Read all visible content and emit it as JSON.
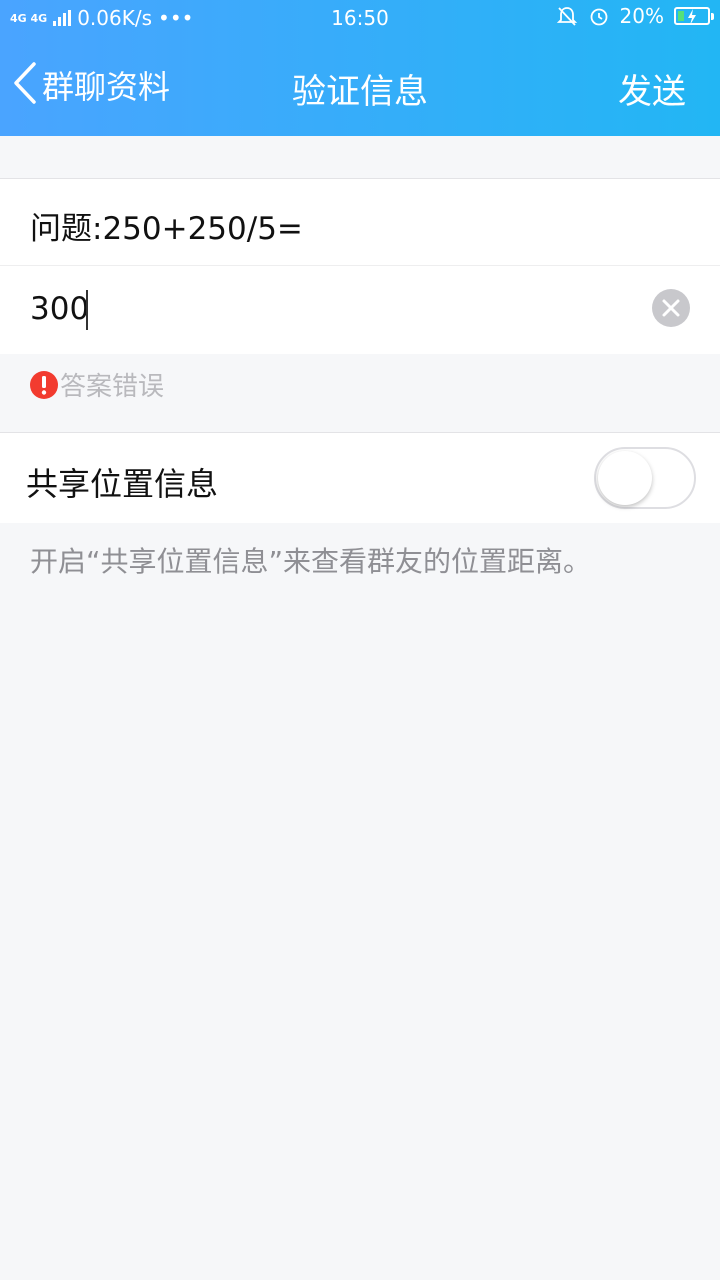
{
  "status_bar": {
    "network": "4G 4G",
    "speed": "0.06K/s",
    "more": "•••",
    "time": "16:50",
    "battery": "20%",
    "battery_level": 0.2
  },
  "nav": {
    "back_label": "群聊资料",
    "title": "验证信息",
    "send_label": "发送"
  },
  "question": {
    "text": "问题:250+250/5="
  },
  "answer": {
    "value": "300"
  },
  "error": {
    "text": "答案错误"
  },
  "share_location": {
    "label": "共享位置信息",
    "enabled": false,
    "hint": "开启“共享位置信息”来查看群友的位置距离。"
  },
  "colors": {
    "header_start": "#4aa4ff",
    "header_end": "#22b6f4",
    "error_icon": "#f23b2f",
    "battery_fill": "#55e07a"
  }
}
